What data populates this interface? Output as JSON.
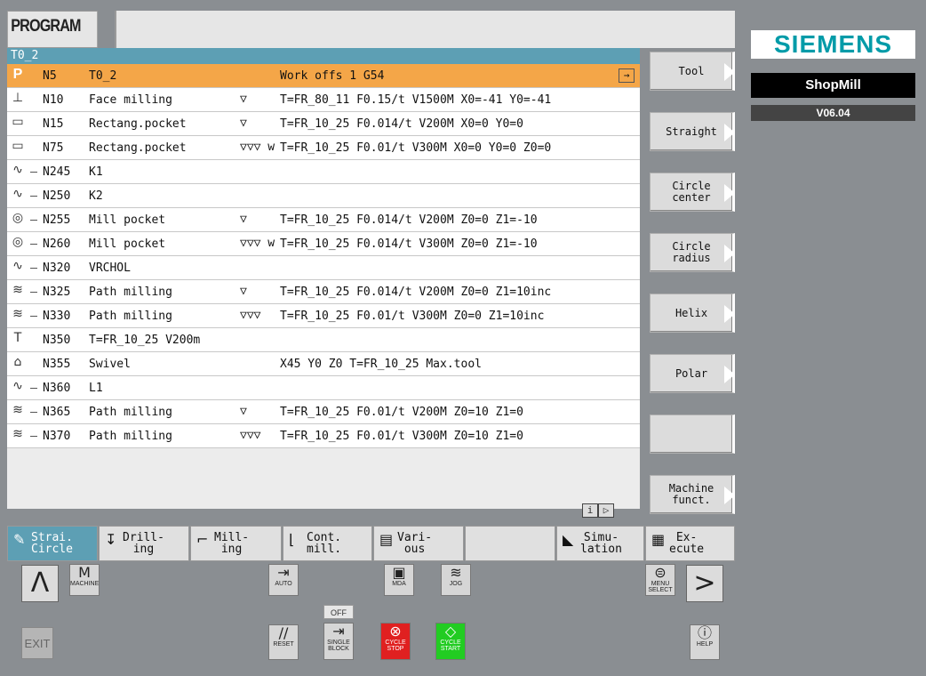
{
  "header": {
    "title": "PROGRAM",
    "path": "T0_2"
  },
  "rows": [
    {
      "icon": "P",
      "n": "N5",
      "name": "T0_2",
      "sym": "",
      "params": "Work offs 1 G54",
      "selected": true
    },
    {
      "icon": "⊥",
      "n": "N10",
      "name": "Face milling",
      "sym": "▽",
      "params": "T=FR_80_11 F0.15/t V1500M X0=-41 Y0=-41"
    },
    {
      "icon": "▭",
      "n": "N15",
      "name": "Rectang.pocket",
      "sym": "▽",
      "params": "T=FR_10_25 F0.014/t V200M X0=0 Y0=0"
    },
    {
      "icon": "▭",
      "n": "N75",
      "name": "Rectang.pocket",
      "sym": "▽▽▽ w",
      "params": "T=FR_10_25 F0.01/t V300M X0=0 Y0=0 Z0=0"
    },
    {
      "icon": "∿",
      "n": "N245",
      "name": "K1",
      "sym": "",
      "params": ""
    },
    {
      "icon": "∿",
      "n": "N250",
      "name": "K2",
      "sym": "",
      "params": ""
    },
    {
      "icon": "◎",
      "n": "N255",
      "name": "Mill pocket",
      "sym": "▽",
      "params": "T=FR_10_25 F0.014/t V200M Z0=0 Z1=-10"
    },
    {
      "icon": "◎",
      "n": "N260",
      "name": "Mill pocket",
      "sym": "▽▽▽ w",
      "params": "T=FR_10_25 F0.014/t V300M Z0=0 Z1=-10"
    },
    {
      "icon": "∿",
      "n": "N320",
      "name": "VRCHOL",
      "sym": "",
      "params": ""
    },
    {
      "icon": "≋",
      "n": "N325",
      "name": "Path milling",
      "sym": "▽",
      "params": "T=FR_10_25 F0.014/t V200M Z0=0 Z1=10inc"
    },
    {
      "icon": "≋",
      "n": "N330",
      "name": "Path milling",
      "sym": "▽▽▽",
      "params": "T=FR_10_25 F0.01/t V300M Z0=0 Z1=10inc"
    },
    {
      "icon": "T",
      "n": "N350",
      "name": "T=FR_10_25 V200m",
      "sym": "",
      "params": ""
    },
    {
      "icon": "⌂",
      "n": "N355",
      "name": "Swivel",
      "sym": "",
      "params": "X45 Y0 Z0 T=FR_10_25 Max.tool"
    },
    {
      "icon": "∿",
      "n": "N360",
      "name": "L1",
      "sym": "",
      "params": ""
    },
    {
      "icon": "≋",
      "n": "N365",
      "name": "Path milling",
      "sym": "▽",
      "params": "T=FR_10_25 F0.01/t V200M Z0=10 Z1=0"
    },
    {
      "icon": "≋",
      "n": "N370",
      "name": "Path milling",
      "sym": "▽▽▽",
      "params": "T=FR_10_25 F0.01/t V300M Z0=10 Z1=0"
    }
  ],
  "nav_indicator": {
    "info": "i",
    "next": "▷"
  },
  "softkeys_right": [
    {
      "label": "Tool",
      "arrow": true
    },
    {
      "label": "Straight",
      "arrow": true
    },
    {
      "label": "Circle\ncenter",
      "arrow": true
    },
    {
      "label": "Circle\nradius",
      "arrow": true
    },
    {
      "label": "Helix",
      "arrow": true
    },
    {
      "label": "Polar",
      "arrow": true
    },
    {
      "label": "",
      "arrow": false
    },
    {
      "label": "Machine\nfunct.",
      "arrow": true
    }
  ],
  "brand": {
    "logo": "SIEMENS",
    "product": "ShopMill",
    "version": "V06.04"
  },
  "softkeys_bottom": [
    {
      "label": "Strai.\nCircle",
      "active": true
    },
    {
      "label": "Drill-\ning"
    },
    {
      "label": "Mill-\ning"
    },
    {
      "label": "Cont.\nmill."
    },
    {
      "label": "Vari-\nous"
    },
    {
      "label": ""
    },
    {
      "label": "Simu-\nlation"
    },
    {
      "label": "Ex-\necute"
    }
  ],
  "machine_panel": {
    "machine": "MACHINE",
    "auto": "AUTO",
    "mda": "MDA",
    "jog": "JOG",
    "menu_select": "MENU SELECT",
    "reset": "RESET",
    "single_block": "SINGLE BLOCK",
    "cycle_stop": "CYCLE STOP",
    "cycle_start": "CYCLE START",
    "help": "HELP",
    "exit": "EXIT",
    "off": "OFF",
    "up": "Λ",
    "right": ">"
  },
  "colors": {
    "accent": "#5d9fb4",
    "selected": "#f4a648",
    "siemens": "#009ba8"
  }
}
